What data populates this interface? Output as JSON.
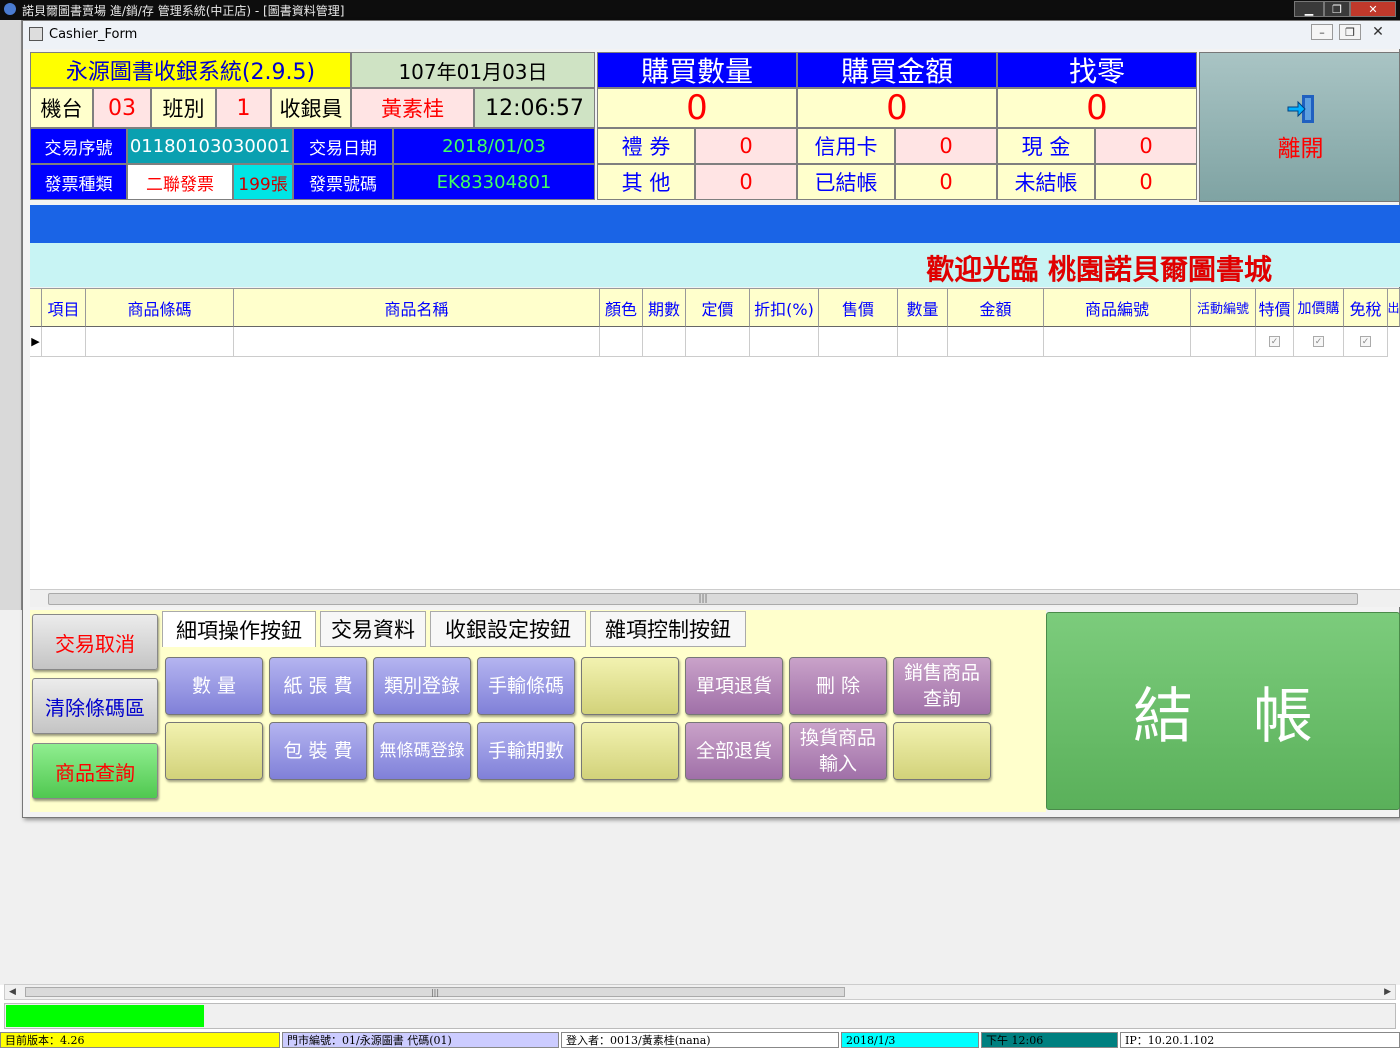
{
  "outer_window": {
    "title": "諾貝爾圖書賣場 進/銷/存 管理系統(中正店) - [圖書資料管理]"
  },
  "cashier_window": {
    "title": "Cashier_Form"
  },
  "header": {
    "system_name": "永源圖書收銀系統(2.9.5)",
    "roc_date": "107年01月03日",
    "machine_label": "機台",
    "machine_value": "03",
    "shift_label": "班別",
    "shift_value": "1",
    "cashier_label": "收銀員",
    "cashier_value": "黃素桂",
    "time": "12:06:57",
    "txn_no_label": "交易序號",
    "txn_no_value": "01180103030001",
    "txn_date_label": "交易日期",
    "txn_date_value": "2018/01/03",
    "invoice_type_label": "發票種類",
    "invoice_type_value": "二聯發票",
    "invoice_count": "199張",
    "invoice_no_label": "發票號碼",
    "invoice_no_value": "EK83304801"
  },
  "totals": {
    "qty_label": "購買數量",
    "qty_value": "0",
    "amount_label": "購買金額",
    "amount_value": "0",
    "change_label": "找零",
    "change_value": "0"
  },
  "payments": {
    "gift_label": "禮 券",
    "gift_value": "0",
    "credit_label": "信用卡",
    "credit_value": "0",
    "cash_label": "現 金",
    "cash_value": "0",
    "other_label": "其 他",
    "other_value": "0",
    "settled_label": "已結帳",
    "settled_value": "0",
    "unsettled_label": "未結帳",
    "unsettled_value": "0"
  },
  "exit_button": {
    "label": "離開"
  },
  "welcome": "歡迎光臨 桃園諾貝爾圖書城",
  "grid": {
    "columns": [
      "項目",
      "商品條碼",
      "商品名稱",
      "顏色",
      "期數",
      "定價",
      "折扣(%)",
      "售價",
      "數量",
      "金額",
      "商品編號",
      "活動編號",
      "特價",
      "加價購",
      "免稅",
      "出"
    ],
    "row_pointer": "▶",
    "check_mark": "✓"
  },
  "side_buttons": {
    "cancel": "交易取消",
    "clear_barcode": "清除條碼區",
    "product_query": "商品查詢"
  },
  "tabs": [
    "細項操作按鈕",
    "交易資料",
    "收銀設定按鈕",
    "雜項控制按鈕"
  ],
  "function_buttons": {
    "quantity": "數 量",
    "paper_fee": "紙 張 費",
    "category_register": "類別登錄",
    "manual_barcode": "手輸條碼",
    "single_return": "單項退貨",
    "delete": "刪 除",
    "sales_query_line1": "銷售商品",
    "sales_query_line2": "查詢",
    "packaging_fee": "包 裝 費",
    "no_barcode_register": "無條碼登錄",
    "manual_issue": "手輸期數",
    "all_return": "全部退貨",
    "exchange_line1": "換貨商品",
    "exchange_line2": "輸入"
  },
  "checkout_button": {
    "label": "結　帳"
  },
  "status_bar": {
    "version": "目前版本：4.26",
    "store": "門市編號：01/永源圖書 代碼(01)",
    "login": "登入者：0013/黃素桂(nana)",
    "date": "2018/1/3",
    "time": "下午 12:06",
    "ip": "IP：10.20.1.102"
  },
  "colors": {
    "blue_header": "#0000ff",
    "yellow": "#ffff00",
    "cream": "#ffffcc",
    "pink": "#ffe4e4",
    "progress_green": "#00ff00",
    "checkout_green": "#6fbf6f"
  }
}
